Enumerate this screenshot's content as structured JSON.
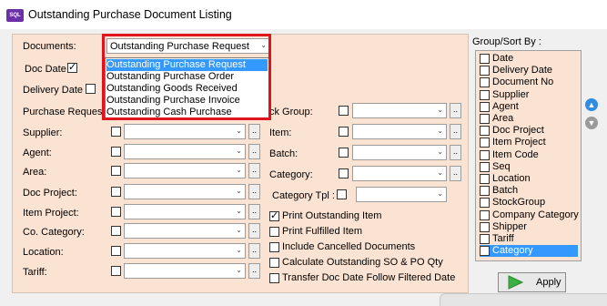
{
  "window": {
    "title": "Outstanding Purchase Document Listing",
    "icon_text": "SQL ACC"
  },
  "documents": {
    "label": "Documents:",
    "selected": "Outstanding Purchase Request",
    "options": [
      "Outstanding Purchase Request",
      "Outstanding Purchase Order",
      "Outstanding Goods Received",
      "Outstanding Purchase Invoice",
      "Outstanding Cash Purchase"
    ]
  },
  "doc_date": {
    "label": "Doc Date",
    "checked": true
  },
  "delivery_date": {
    "label": "Delivery Date",
    "checked": false
  },
  "left_filters": [
    "Purchase Request:",
    "Supplier:",
    "Agent:",
    "Area:",
    "Doc Project:",
    "Item Project:",
    "Co. Category:",
    "Location:",
    "Tariff:"
  ],
  "right_filters": {
    "stock_group": "ck Group:",
    "item": "Item:",
    "batch": "Batch:",
    "category": "Category:",
    "category_tpl": "Category Tpl :"
  },
  "options": [
    {
      "label": "Print Outstanding Item",
      "checked": true
    },
    {
      "label": "Print Fulfilled Item",
      "checked": false
    },
    {
      "label": "Include Cancelled Documents",
      "checked": false
    },
    {
      "label": "Calculate Outstanding SO & PO Qty",
      "checked": false
    },
    {
      "label": "Transfer Doc Date Follow Filtered Date",
      "checked": false
    }
  ],
  "group_sort": {
    "label": "Group/Sort By :",
    "items": [
      "Date",
      "Delivery Date",
      "Document No",
      "Supplier",
      "Agent",
      "Area",
      "Doc Project",
      "Item Project",
      "Item Code",
      "Seq",
      "Location",
      "Batch",
      "StockGroup",
      "Company Category",
      "Shipper",
      "Tariff",
      "Category"
    ],
    "selected_index": 16
  },
  "apply_label": "Apply",
  "colors": {
    "panel": "#fbe3d3",
    "highlight": "#3399ff",
    "red_box": "#e0141e",
    "apply_icon": "#3cb043"
  }
}
